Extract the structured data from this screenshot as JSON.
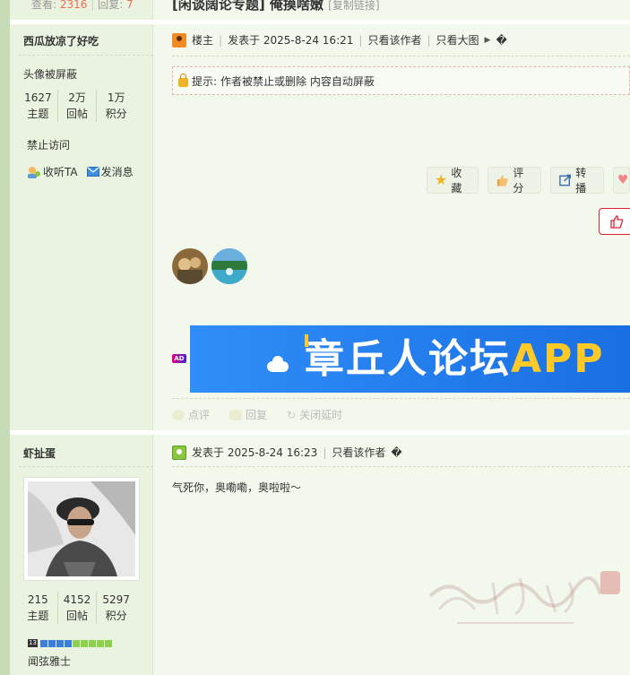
{
  "thread": {
    "top_stats": {
      "views_label": "查看:",
      "views": "2316",
      "replies_label": "回复:",
      "replies": "7"
    },
    "title": "[闲谈阔论专题] 俺摸啥嫩",
    "copy_link": "[复制链接]"
  },
  "post1": {
    "author": "西瓜放凉了好吃",
    "avatar_notice": "头像被屏蔽",
    "stats": [
      {
        "value": "1627",
        "label": "主题"
      },
      {
        "value": "2万",
        "label": "回帖"
      },
      {
        "value": "1万",
        "label": "积分"
      }
    ],
    "ban_status": "禁止访问",
    "follow": "收听TA",
    "message": "发消息",
    "header": {
      "role": "楼主",
      "posted": "发表于 2025-8-24 16:21",
      "only_author": "只看该作者",
      "only_large": "只看大图",
      "glyph": "�"
    },
    "notice": {
      "prefix": "提示:",
      "text": "作者被禁止或删除 内容自动屏蔽"
    },
    "actions": [
      "收藏",
      "评分",
      "转播"
    ],
    "ad_tag": "AD",
    "banner": {
      "text": "章丘人论坛",
      "app": "APP"
    },
    "reply_actions": [
      "点评",
      "回复",
      "关闭延时"
    ]
  },
  "post2": {
    "author": "虾扯蛋",
    "stats": [
      {
        "value": "215",
        "label": "主题"
      },
      {
        "value": "4152",
        "label": "回帖"
      },
      {
        "value": "5297",
        "label": "积分"
      }
    ],
    "rank_prefix": "13",
    "grade": "闻弦雅士",
    "header": {
      "posted": "发表于 2025-8-24 16:23",
      "only_author": "只看该作者",
      "glyph": "�"
    },
    "content": "气死你，奥嘞嘞，奥啦啦～"
  },
  "colors": {
    "accent_orange": "#f26c4f",
    "banner_blue": "#2f8ef7",
    "banner_app": "#ffc928"
  }
}
